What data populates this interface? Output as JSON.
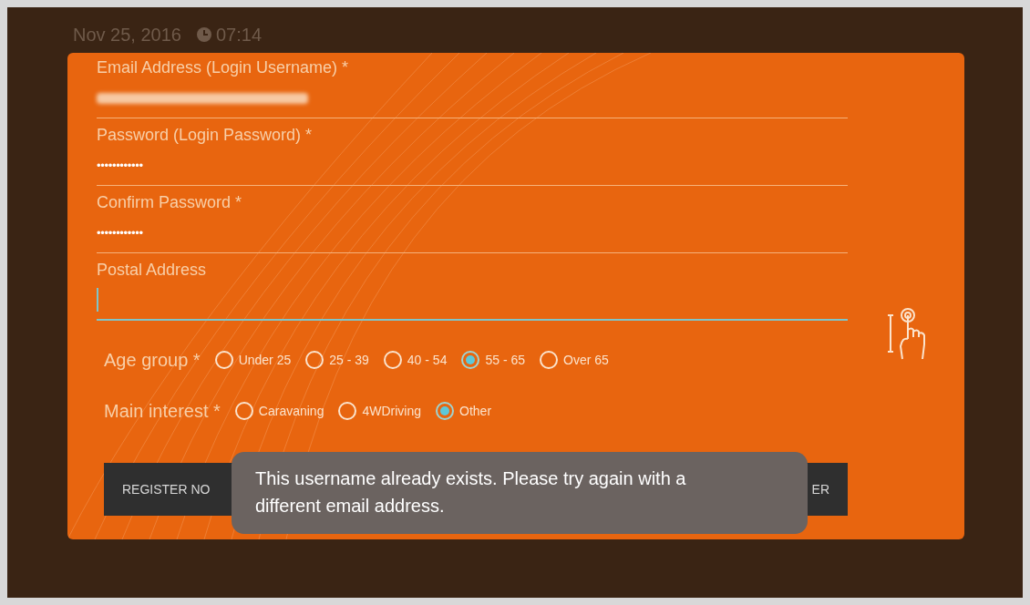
{
  "status": {
    "date": "Nov 25, 2016",
    "time": "07:14"
  },
  "fields": [
    {
      "label": "Email Address (Login Username) *",
      "kind": "blurred",
      "focused": false
    },
    {
      "label": "Password (Login Password) *",
      "kind": "password",
      "value": "••••••••••••",
      "focused": false
    },
    {
      "label": "Confirm Password *",
      "kind": "password",
      "value": "••••••••••••",
      "focused": false
    },
    {
      "label": "Postal Address",
      "kind": "text",
      "focused": true
    }
  ],
  "radio_groups": [
    {
      "label": "Age group *",
      "options": [
        {
          "label": "Under 25",
          "selected": false
        },
        {
          "label": "25 - 39",
          "selected": false
        },
        {
          "label": "40 - 54",
          "selected": false
        },
        {
          "label": "55 - 65",
          "selected": true
        },
        {
          "label": "Over 65",
          "selected": false
        }
      ]
    },
    {
      "label": "Main interest *",
      "options": [
        {
          "label": "Caravaning",
          "selected": false
        },
        {
          "label": "4WDriving",
          "selected": false
        },
        {
          "label": "Other",
          "selected": true
        }
      ]
    }
  ],
  "buttons": [
    "REGISTER NO",
    "ER"
  ],
  "toast": "This username already exists. Please try again with a different email address."
}
